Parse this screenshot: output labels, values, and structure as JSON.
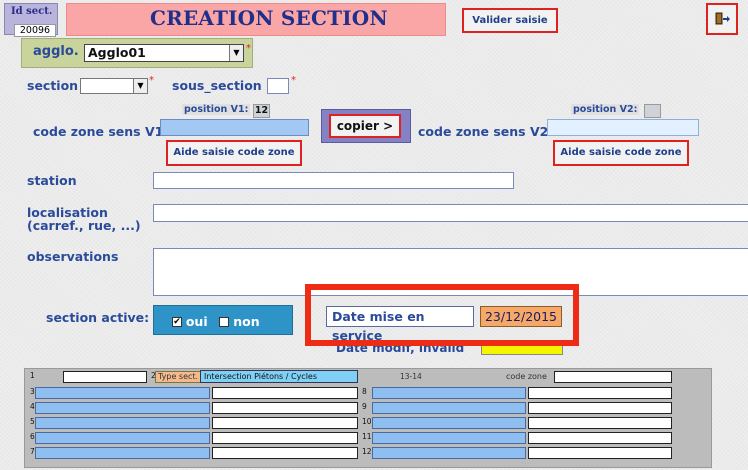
{
  "header": {
    "id_label": "Id sect.",
    "id_value": "20096",
    "title": "CREATION SECTION",
    "validate_button": "Valider saisie"
  },
  "agglo": {
    "label": "agglo.",
    "value": "Agglo01",
    "required_mark": "*"
  },
  "section": {
    "label": "section",
    "value": "",
    "required_mark": "*"
  },
  "sous_section": {
    "label": "sous_section",
    "value": "",
    "required_mark": "*"
  },
  "v1": {
    "position_label": "position V1:",
    "position_value": "12",
    "code_label": "code zone sens V1",
    "code_value": "",
    "aide_button": "Aide saisie code zone"
  },
  "copier_button": "copier >",
  "v2": {
    "position_label": "position V2:",
    "position_value": "",
    "code_label": "code zone sens V2",
    "code_value": "",
    "aide_button": "Aide saisie code zone"
  },
  "station": {
    "label": "station",
    "value": ""
  },
  "localisation": {
    "label_line1": "localisation",
    "label_line2": "(carref., rue, ...)",
    "value": ""
  },
  "observations": {
    "label": "observations",
    "value": ""
  },
  "section_active": {
    "label": "section active:",
    "oui_label": "oui",
    "oui_checked": true,
    "non_label": "non",
    "non_checked": false
  },
  "dates": {
    "mise_en_service_label": "Date mise en service",
    "mise_en_service_value": "23/12/2015",
    "modif_label": "Date modif, invalid"
  },
  "lower_panel": {
    "row1_num": "1",
    "row2_num": "2",
    "type_sect_label": "Type sect.",
    "type_sect_value": "Intersection Piétons / Cycles",
    "range_label": "13-14",
    "code_zone_label": "code zone",
    "left_numbers": [
      "3",
      "4",
      "5",
      "6",
      "7"
    ],
    "right_numbers": [
      "8",
      "9",
      "10",
      "11",
      "12"
    ]
  },
  "colors": {
    "title_bar": "#fba6a6",
    "agglo_panel": "#c8d49c",
    "highlight_red": "#ee2b15",
    "date_orange": "#f5a965",
    "active_panel": "#2e94c8"
  }
}
